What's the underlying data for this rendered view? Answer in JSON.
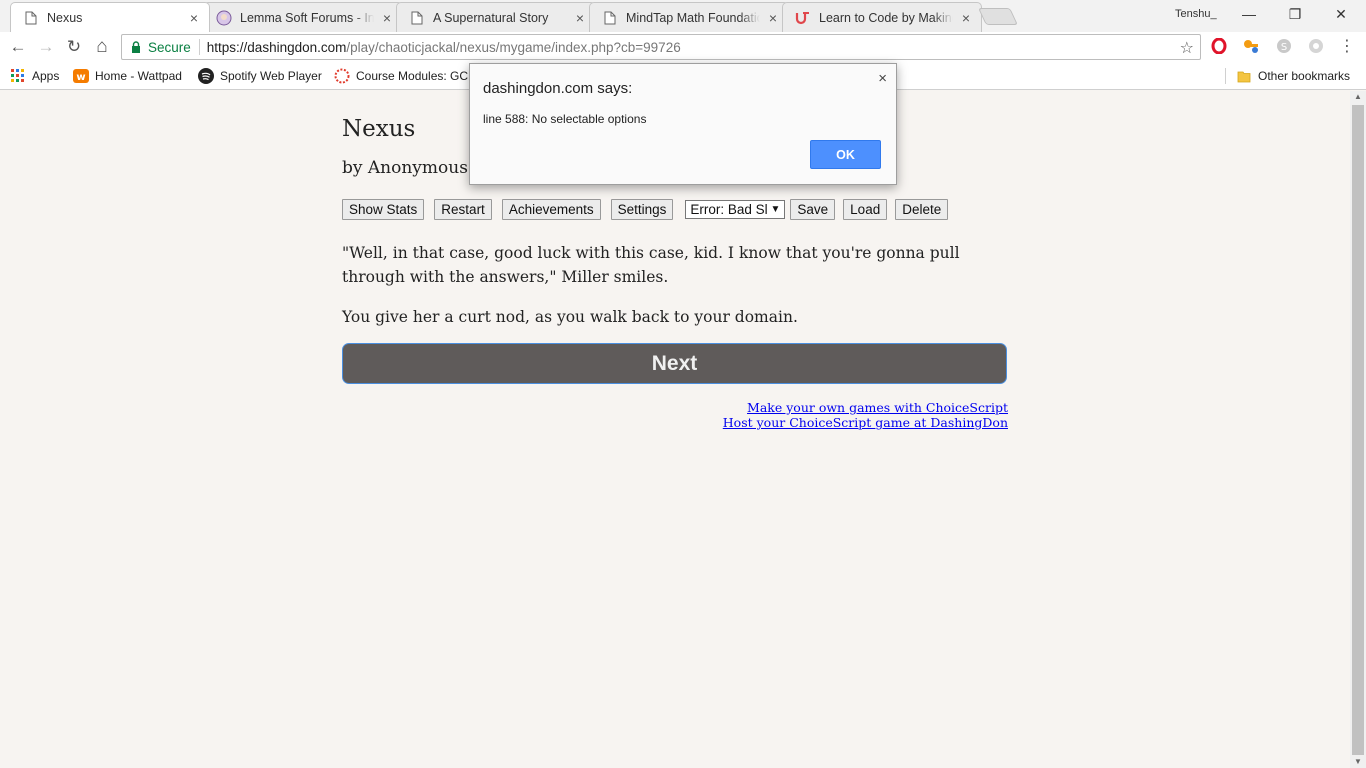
{
  "browser": {
    "tabs": [
      {
        "title": "Nexus",
        "active": true,
        "icon": "page-icon"
      },
      {
        "title": "Lemma Soft Forums - Ind",
        "active": false,
        "icon": "avatar-icon"
      },
      {
        "title": "A Supernatural Story",
        "active": false,
        "icon": "page-icon"
      },
      {
        "title": "MindTap Math Foundatio",
        "active": false,
        "icon": "page-icon"
      },
      {
        "title": "Learn to Code by Making",
        "active": false,
        "icon": "udemy-icon"
      }
    ],
    "tab_close_glyph": "×",
    "profile_name": "Tenshu_",
    "window_controls": {
      "minimize": "—",
      "restore": "❐",
      "close": "✕"
    },
    "nav": {
      "back": "←",
      "forward": "→",
      "reload": "↻",
      "home": "⌂"
    },
    "address": {
      "secure_label": "Secure",
      "url_scheme_host": "https://dashingdon.com",
      "url_rest": "/play/chaoticjackal/nexus/mygame/index.php?cb=99726"
    },
    "star_glyph": "☆",
    "bookmarks": [
      {
        "label": "Apps",
        "icon": "apps-grid-icon"
      },
      {
        "label": "Home - Wattpad",
        "icon": "wattpad-icon"
      },
      {
        "label": "Spotify Web Player",
        "icon": "spotify-icon"
      },
      {
        "label": "Course Modules: GC",
        "icon": "canvas-icon"
      }
    ],
    "other_bookmarks": "Other bookmarks"
  },
  "game": {
    "title": "Nexus",
    "author": "by Anonymous",
    "buttons": {
      "show_stats": "Show Stats",
      "restart": "Restart",
      "achievements": "Achievements",
      "settings": "Settings",
      "save": "Save",
      "load": "Load",
      "delete": "Delete"
    },
    "save_slot_select": "Error: Bad Sl",
    "story": [
      "\"Well, in that case, good luck with this case, kid. I know that you're gonna pull through with the answers,\" Miller smiles.",
      "You give her a curt nod, as you walk back to your domain."
    ],
    "next_label": "Next",
    "footer_links": [
      "Make your own games with ChoiceScript",
      "Host your ChoiceScript game at DashingDon"
    ]
  },
  "dialog": {
    "title": "dashingdon.com says:",
    "message": "line 588: No selectable options",
    "ok_label": "OK",
    "close_glyph": "×"
  },
  "colors": {
    "page_bg": "#f7f4f1",
    "next_button": "#5f5b5a",
    "dialog_ok": "#4d90fe",
    "secure_green": "#0b8043",
    "link_blue": "#0000ee"
  }
}
